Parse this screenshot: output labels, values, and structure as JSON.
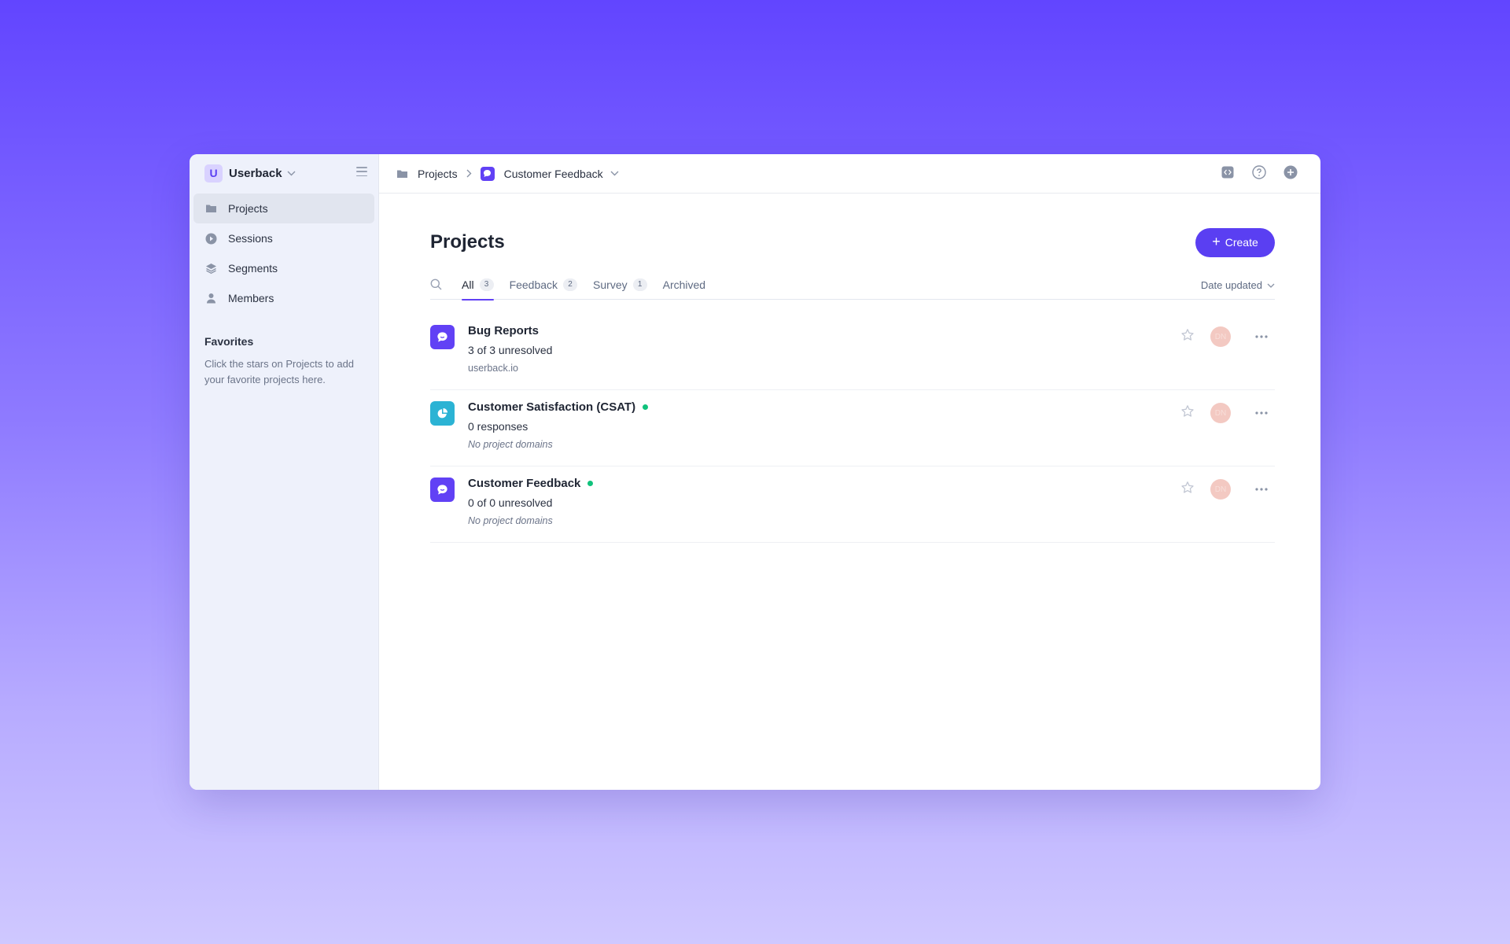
{
  "workspace": {
    "initial": "U",
    "name": "Userback"
  },
  "sidebar": {
    "items": [
      {
        "label": "Projects",
        "icon": "folder-icon",
        "active": true
      },
      {
        "label": "Sessions",
        "icon": "play-circle-icon"
      },
      {
        "label": "Segments",
        "icon": "layers-icon"
      },
      {
        "label": "Members",
        "icon": "user-icon"
      }
    ],
    "favorites_title": "Favorites",
    "favorites_text": "Click the stars on Projects to add your favorite projects here."
  },
  "breadcrumb": {
    "root": "Projects",
    "current": "Customer Feedback"
  },
  "header": {
    "title": "Projects",
    "create_label": "Create"
  },
  "tabs": [
    {
      "label": "All",
      "count": "3",
      "active": true
    },
    {
      "label": "Feedback",
      "count": "2"
    },
    {
      "label": "Survey",
      "count": "1"
    },
    {
      "label": "Archived",
      "count": null
    }
  ],
  "sort": {
    "label": "Date updated"
  },
  "projects": [
    {
      "name": "Bug Reports",
      "status": "3 of 3 unresolved",
      "domain": "userback.io",
      "type": "feedback",
      "active_dot": false,
      "avatar": "DN"
    },
    {
      "name": "Customer Satisfaction (CSAT)",
      "status": "0 responses",
      "domain": "No project domains",
      "type": "survey",
      "active_dot": true,
      "avatar": "DN"
    },
    {
      "name": "Customer Feedback",
      "status": "0 of 0 unresolved",
      "domain": "No project domains",
      "type": "feedback",
      "active_dot": true,
      "avatar": "DN"
    }
  ],
  "colors": {
    "accent": "#5a3ff2",
    "feedback_icon": "#6141f5",
    "survey_icon": "#2bb3d4",
    "active_dot": "#10c27c",
    "avatar_bg": "#f3c9c2"
  }
}
